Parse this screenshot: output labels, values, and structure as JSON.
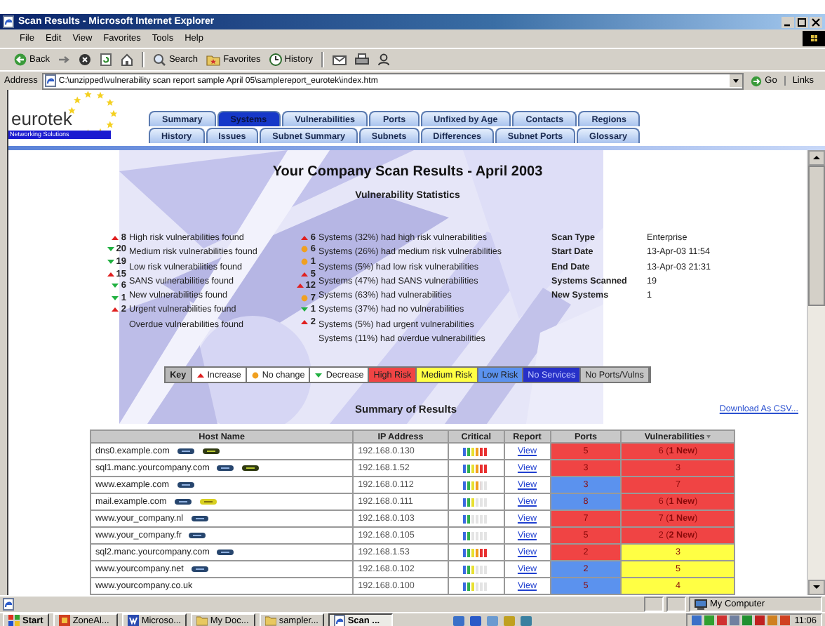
{
  "window": {
    "title": "Scan Results - Microsoft Internet Explorer"
  },
  "menu": [
    "File",
    "Edit",
    "View",
    "Favorites",
    "Tools",
    "Help"
  ],
  "toolbar": [
    {
      "kind": "back",
      "label": "Back"
    },
    {
      "kind": "forward"
    },
    {
      "kind": "stop"
    },
    {
      "kind": "refresh"
    },
    {
      "kind": "home"
    },
    {
      "kind": "search",
      "label": "Search"
    },
    {
      "kind": "favorites",
      "label": "Favorites"
    },
    {
      "kind": "history",
      "label": "History"
    },
    {
      "kind": "mail"
    },
    {
      "kind": "print"
    },
    {
      "kind": "messenger"
    }
  ],
  "address": {
    "label": "Address",
    "value": "C:\\unzipped\\vulnerability scan report sample April 05\\samplereport_eurotek\\index.htm",
    "go": "Go",
    "links": "Links"
  },
  "logo": {
    "name": "eurotek",
    "tagline": "Networking Solutions"
  },
  "tab_rows": [
    {
      "tabs": [
        {
          "label": "Summary",
          "selected": false
        },
        {
          "label": "Systems",
          "selected": true
        },
        {
          "label": "Vulnerabilities",
          "selected": false
        },
        {
          "label": "Ports",
          "selected": false
        },
        {
          "label": "Unfixed by Age",
          "selected": false
        },
        {
          "label": "Contacts",
          "selected": false
        },
        {
          "label": "Regions",
          "selected": false
        }
      ]
    },
    {
      "tabs": [
        {
          "label": "History",
          "selected": false
        },
        {
          "label": "Issues",
          "selected": false
        },
        {
          "label": "Subnet Summary",
          "selected": false
        },
        {
          "label": "Subnets",
          "selected": false
        },
        {
          "label": "Differences",
          "selected": false
        },
        {
          "label": "Subnet Ports",
          "selected": false
        },
        {
          "label": "Glossary",
          "selected": false
        }
      ]
    }
  ],
  "heading": "Your Company Scan Results - April 2003",
  "subheading": "Vulnerability Statistics",
  "finding_changes": [
    {
      "kind": "increase",
      "count": "8"
    },
    {
      "kind": "decrease",
      "count": "20"
    },
    {
      "kind": "decrease",
      "count": "19"
    },
    {
      "kind": "increase",
      "count": "15"
    },
    {
      "kind": "decrease",
      "count": "6"
    },
    {
      "kind": "decrease",
      "count": "1"
    },
    {
      "kind": "increase",
      "count": "2"
    }
  ],
  "findings": [
    "High risk vulnerabilities found",
    "Medium risk vulnerabilities found",
    "Low risk vulnerabilities found",
    "SANS vulnerabilities found",
    "New vulnerabilities found",
    "Urgent vulnerabilities found",
    "Overdue vulnerabilities found"
  ],
  "system_changes": [
    {
      "kind": "increase",
      "count": "6"
    },
    {
      "kind": "unchanged",
      "count": "6"
    },
    {
      "kind": "unchanged",
      "count": "1"
    },
    {
      "kind": "increase",
      "count": "5"
    },
    {
      "kind": "increase",
      "count": "12"
    },
    {
      "kind": "unchanged",
      "count": "7"
    },
    {
      "kind": "decrease",
      "count": "1"
    },
    {
      "kind": "increase",
      "count": "2"
    }
  ],
  "system_stats": [
    "Systems (32%) had high risk vulnerabilities",
    "Systems (26%) had medium risk vulnerabilities",
    "Systems (5%) had low risk vulnerabilities",
    "Systems (47%) had SANS vulnerabilities",
    "Systems (63%) had vulnerabilities",
    "Systems (37%) had no vulnerabilities",
    "Systems (5%) had urgent vulnerabilities",
    "Systems (11%) had overdue vulnerabilities"
  ],
  "scan_info": [
    {
      "label": "Scan Type",
      "value": "Enterprise"
    },
    {
      "label": "Start Date",
      "value": "13-Apr-03 11:54"
    },
    {
      "label": "End Date",
      "value": "13-Apr-03 21:31"
    },
    {
      "label": "Systems Scanned",
      "value": "19"
    },
    {
      "label": "New Systems",
      "value": "1"
    }
  ],
  "key": [
    {
      "kind": "title",
      "label": "Key"
    },
    {
      "kind": "increase",
      "label": "Increase"
    },
    {
      "kind": "unchanged",
      "label": "No change"
    },
    {
      "kind": "decrease",
      "label": "Decrease"
    },
    {
      "kind": "risk",
      "label": "High Risk",
      "color": "#f04444"
    },
    {
      "kind": "risk",
      "label": "Medium Risk",
      "color": "#ffff44"
    },
    {
      "kind": "risk",
      "label": "Low Risk",
      "color": "#5b92ee"
    },
    {
      "kind": "risk",
      "label": "No Services",
      "color": "#2630c8"
    },
    {
      "kind": "risk",
      "label": "No Ports/Vulns",
      "color": "#c4c4c4"
    }
  ],
  "summary": {
    "title": "Summary of Results",
    "download": "Download As CSV...",
    "columns": [
      {
        "label": "Host Name",
        "sorted": false
      },
      {
        "label": "IP Address",
        "sorted": false
      },
      {
        "label": "Critical",
        "sorted": false
      },
      {
        "label": "Report",
        "sorted": false
      },
      {
        "label": "Ports",
        "sorted": false
      },
      {
        "label": "Vulnerabilities",
        "sorted": true
      }
    ],
    "rows": [
      {
        "host": "dns0.example.com",
        "tags": [
          {
            "kind": "smb"
          },
          {
            "kind": "lan"
          }
        ],
        "ip": "192.168.0.130",
        "level": 1,
        "report": "View",
        "ports": {
          "text": "5",
          "color": "#f04444"
        },
        "vulns": {
          "text": "6 (**1 New**)",
          "color": "#f04444"
        }
      },
      {
        "host": "sql1.manc.yourcompany.com",
        "tags": [
          {
            "kind": "smb"
          },
          {
            "kind": "lan"
          }
        ],
        "ip": "192.168.1.52",
        "level": 1,
        "report": "View",
        "ports": {
          "text": "3",
          "color": "#f04444"
        },
        "vulns": {
          "text": "3",
          "color": "#f04444"
        }
      },
      {
        "host": "www.example.com",
        "tags": [
          {
            "kind": "smb"
          }
        ],
        "ip": "192.168.0.112",
        "level": 0.67,
        "report": "View",
        "ports": {
          "text": "3",
          "color": "#5b92ee"
        },
        "vulns": {
          "text": "7",
          "color": "#f04444"
        }
      },
      {
        "host": "mail.example.com",
        "tags": [
          {
            "kind": "smb"
          },
          {
            "kind": "urgent"
          }
        ],
        "ip": "192.168.0.111",
        "level": 0.5,
        "report": "View",
        "ports": {
          "text": "8",
          "color": "#5b92ee"
        },
        "vulns": {
          "text": "6 (**1 New**)",
          "color": "#f04444"
        }
      },
      {
        "host": "www.your_company.nl",
        "tags": [
          {
            "kind": "smb"
          }
        ],
        "ip": "192.168.0.103",
        "level": 0.33,
        "report": "View",
        "ports": {
          "text": "7",
          "color": "#f04444"
        },
        "vulns": {
          "text": "7 (**1 New**)",
          "color": "#f04444"
        }
      },
      {
        "host": "www.your_company.fr",
        "tags": [
          {
            "kind": "smb"
          }
        ],
        "ip": "192.168.0.105",
        "level": 0.33,
        "report": "View",
        "ports": {
          "text": "5",
          "color": "#f04444"
        },
        "vulns": {
          "text": "2 (**2 New**)",
          "color": "#f04444"
        }
      },
      {
        "host": "sql2.manc.yourcompany.com",
        "tags": [
          {
            "kind": "smb"
          }
        ],
        "ip": "192.168.1.53",
        "level": 1,
        "report": "View",
        "ports": {
          "text": "2",
          "color": "#f04444"
        },
        "vulns": {
          "text": "3",
          "color": "#ffff44"
        }
      },
      {
        "host": "www.yourcompany.net",
        "tags": [
          {
            "kind": "smb"
          }
        ],
        "ip": "192.168.0.102",
        "level": 0.5,
        "report": "View",
        "ports": {
          "text": "2",
          "color": "#5b92ee"
        },
        "vulns": {
          "text": "5",
          "color": "#ffff44"
        }
      },
      {
        "host": "www.yourcompany.co.uk",
        "ip": "192.168.0.100",
        "level": 0.5,
        "report": "View",
        "ports": {
          "text": "5",
          "color": "#5b92ee"
        },
        "vulns": {
          "text": "4",
          "color": "#ffff44"
        }
      }
    ]
  },
  "status_bar": {
    "zone": "My Computer"
  },
  "taskbar": {
    "start": "Start",
    "tasks": [
      {
        "kind": "zone",
        "label": "ZoneAl...",
        "selected": false
      },
      {
        "kind": "word",
        "label": "Microso...",
        "selected": false
      },
      {
        "kind": "folder",
        "label": "My Doc...",
        "selected": false
      },
      {
        "kind": "folder",
        "label": "sampler...",
        "selected": false
      },
      {
        "kind": "browser",
        "label": "Scan ...",
        "selected": true
      }
    ],
    "clock": "11:06"
  }
}
